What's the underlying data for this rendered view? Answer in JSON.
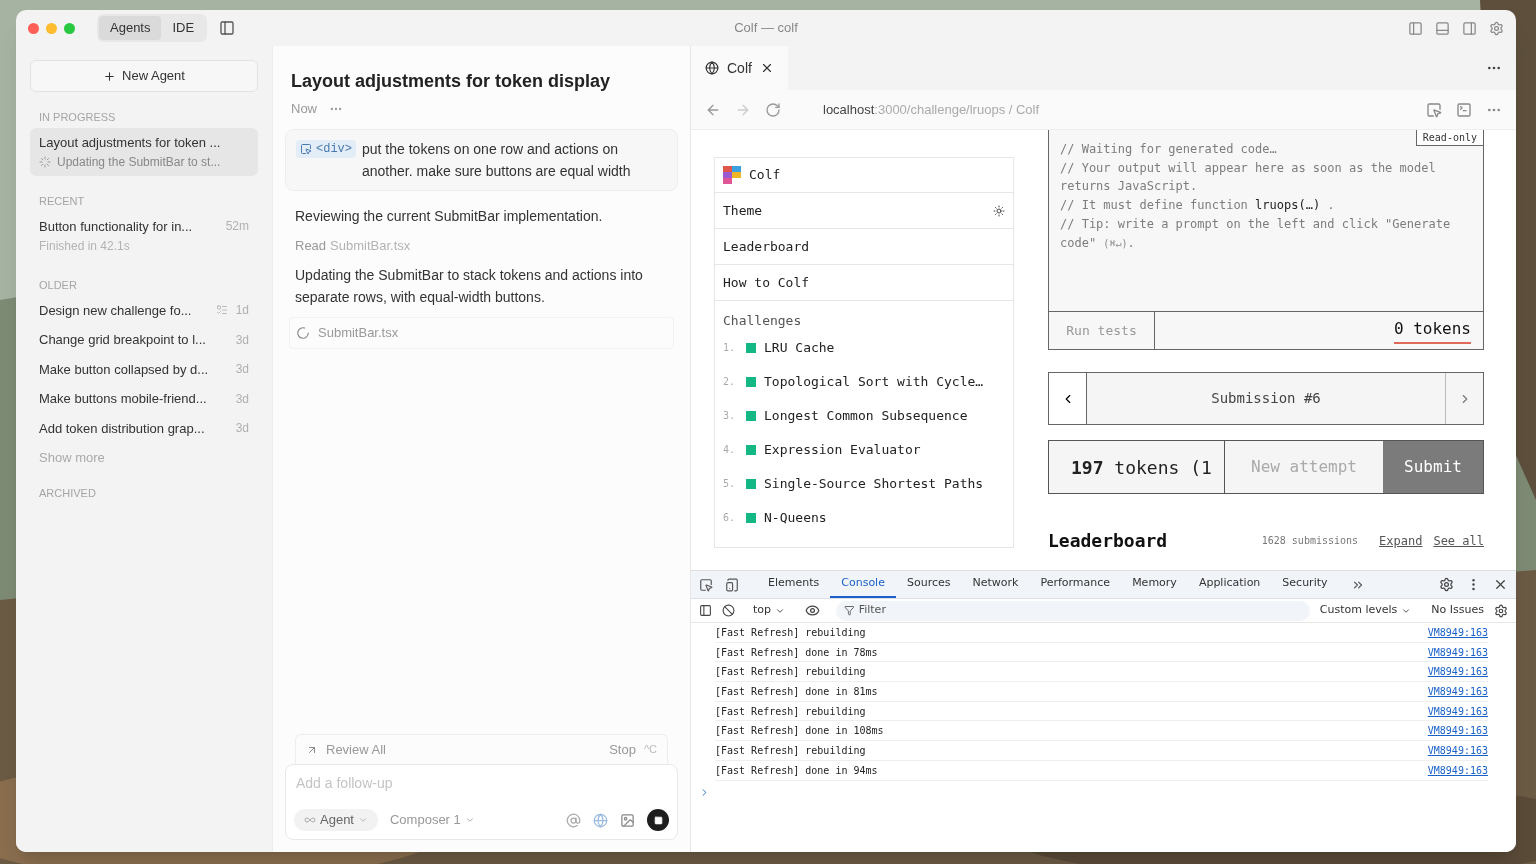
{
  "window": {
    "title": "Colf — colf",
    "mode_tabs": [
      {
        "label": "Agents",
        "selected": true
      },
      {
        "label": "IDE",
        "selected": false
      }
    ]
  },
  "sidebar": {
    "new_agent": "New Agent",
    "sections": [
      {
        "heading": "IN PROGRESS",
        "items": [
          {
            "title": "Layout adjustments for token ...",
            "subtitle": "Updating the SubmitBar to st...",
            "kind": "running",
            "selected": true
          }
        ]
      },
      {
        "heading": "RECENT",
        "items": [
          {
            "title": "Button functionality for in...",
            "time": "52m",
            "subtitle": "Finished in 42.1s",
            "kind": "done",
            "selected": false
          }
        ]
      },
      {
        "heading": "OLDER",
        "items": [
          {
            "title": "Design new challenge fo...",
            "time": "1d",
            "kind": "todo",
            "selected": false
          },
          {
            "title": "Change grid breakpoint to l...",
            "time": "3d",
            "kind": "plain",
            "selected": false
          },
          {
            "title": "Make button collapsed by d...",
            "time": "3d",
            "kind": "plain",
            "selected": false
          },
          {
            "title": "Make buttons mobile-friend...",
            "time": "3d",
            "kind": "plain",
            "selected": false
          },
          {
            "title": "Add token distribution grap...",
            "time": "3d",
            "kind": "plain",
            "selected": false
          }
        ],
        "more": "Show more"
      },
      {
        "heading": "ARCHIVED"
      }
    ]
  },
  "chat": {
    "title": "Layout adjustments for token display",
    "time": "Now",
    "prompt": {
      "tag": "<div>",
      "text": "put the tokens on one row and actions on another. make sure buttons are equal width"
    },
    "messages": [
      {
        "kind": "text",
        "text": "Reviewing the current SubmitBar implementation."
      },
      {
        "kind": "read",
        "verb": "Read",
        "file": "SubmitBar.tsx"
      },
      {
        "kind": "text",
        "text": "Updating the SubmitBar to stack tokens and actions into separate rows, with equal-width buttons."
      },
      {
        "kind": "pending",
        "file": "SubmitBar.tsx"
      }
    ],
    "review_bar": {
      "review": "Review All",
      "stop": "Stop",
      "shortcut": "^C"
    },
    "composer": {
      "placeholder": "Add a follow-up",
      "mode": "Agent",
      "model": "Composer 1"
    }
  },
  "browser": {
    "tab": {
      "title": "Colf"
    },
    "url": {
      "host": "localhost",
      "path": ":3000/challenge/lruops / Colf"
    },
    "page": {
      "nav": {
        "brand": "Colf",
        "items": [
          "Theme",
          "Leaderboard",
          "How to Colf"
        ],
        "challenges_heading": "Challenges",
        "challenges": [
          {
            "num": "1.",
            "title": "LRU Cache"
          },
          {
            "num": "2.",
            "title": "Topological Sort with Cycle…"
          },
          {
            "num": "3.",
            "title": "Longest Common Subsequence"
          },
          {
            "num": "4.",
            "title": "Expression Evaluator"
          },
          {
            "num": "5.",
            "title": "Single-Source Shortest Paths"
          },
          {
            "num": "6.",
            "title": "N-Queens"
          }
        ]
      },
      "editor": {
        "badge": "Read-only",
        "lines": [
          [
            {
              "kind": "comment",
              "text": "// Waiting for generated code…"
            }
          ],
          [
            {
              "kind": "comment",
              "text": "// Your output will appear here as soon as the model returns JavaScript."
            }
          ],
          [
            {
              "kind": "comment",
              "text": "// It must define function "
            },
            {
              "kind": "code",
              "text": "lruops(…)"
            },
            {
              "kind": "comment",
              "text": " ."
            }
          ],
          [
            {
              "kind": "comment",
              "text": "// Tip: write a prompt on the left and click \"Generate code\" "
            },
            {
              "kind": "hint",
              "text": "(⌘↵)"
            },
            {
              "kind": "comment",
              "text": "."
            }
          ]
        ],
        "run_tests": "Run tests",
        "tokens": "0 tokens"
      },
      "submission": "Submission #6",
      "submit_bar": {
        "count": "197",
        "tokens": "tokens (1",
        "new_attempt": "New attempt",
        "submit": "Submit"
      },
      "leaderboard": {
        "heading": "Leaderboard",
        "count": "1628 submissions",
        "links": [
          "Expand",
          "See all"
        ]
      }
    }
  },
  "devtools": {
    "tabs": [
      {
        "label": "Elements",
        "selected": false
      },
      {
        "label": "Console",
        "selected": true
      },
      {
        "label": "Sources",
        "selected": false
      },
      {
        "label": "Network",
        "selected": false
      },
      {
        "label": "Performance",
        "selected": false
      },
      {
        "label": "Memory",
        "selected": false
      },
      {
        "label": "Application",
        "selected": false
      },
      {
        "label": "Security",
        "selected": false
      }
    ],
    "context": "top",
    "filter_placeholder": "Filter",
    "levels": "Custom levels",
    "issues": "No Issues",
    "logs": [
      {
        "message": "[Fast Refresh] rebuilding",
        "source": "VM8949:163"
      },
      {
        "message": "[Fast Refresh] done in 78ms",
        "source": "VM8949:163"
      },
      {
        "message": "[Fast Refresh] rebuilding",
        "source": "VM8949:163"
      },
      {
        "message": "[Fast Refresh] done in 81ms",
        "source": "VM8949:163"
      },
      {
        "message": "[Fast Refresh] rebuilding",
        "source": "VM8949:163"
      },
      {
        "message": "[Fast Refresh] done in 108ms",
        "source": "VM8949:163"
      },
      {
        "message": "[Fast Refresh] rebuilding",
        "source": "VM8949:163"
      },
      {
        "message": "[Fast Refresh] done in 94ms",
        "source": "VM8949:163"
      }
    ]
  }
}
